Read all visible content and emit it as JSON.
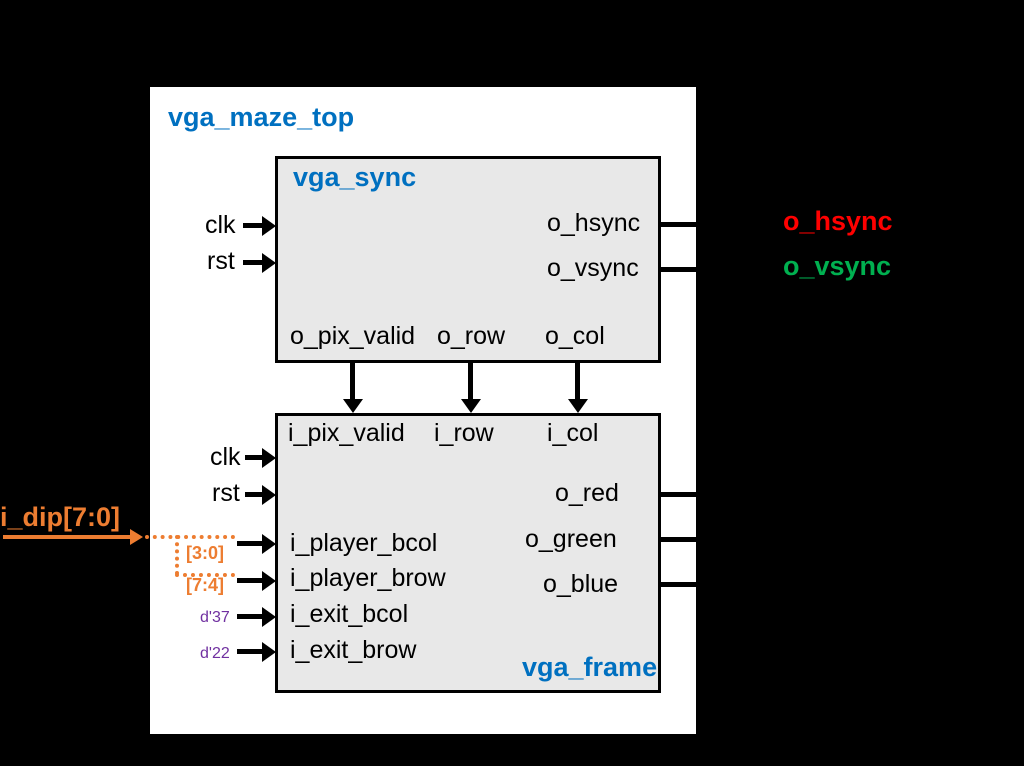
{
  "title": "vga_maze_top",
  "sync": {
    "name": "vga_sync",
    "inputs": {
      "clk": "clk",
      "rst": "rst"
    },
    "outputs": {
      "hsync": "o_hsync",
      "vsync": "o_vsync",
      "pix_valid": "o_pix_valid",
      "row": "o_row",
      "col": "o_col"
    }
  },
  "frame": {
    "name": "vga_frame",
    "inputs": {
      "clk": "clk",
      "rst": "rst",
      "pix_valid": "i_pix_valid",
      "row": "i_row",
      "col": "i_col",
      "pcol": "i_player_bcol",
      "prow": "i_player_brow",
      "ecol": "i_exit_bcol",
      "erow": "i_exit_brow"
    },
    "outputs": {
      "red": "o_red",
      "green": "o_green",
      "blue": "o_blue"
    }
  },
  "external": {
    "dip": "i_dip[7:0]",
    "slice_lo": "[3:0]",
    "slice_hi": "[7:4]",
    "const37": "d'37",
    "const22": "d'22",
    "hsync": "o_hsync",
    "vsync": "o_vsync"
  }
}
